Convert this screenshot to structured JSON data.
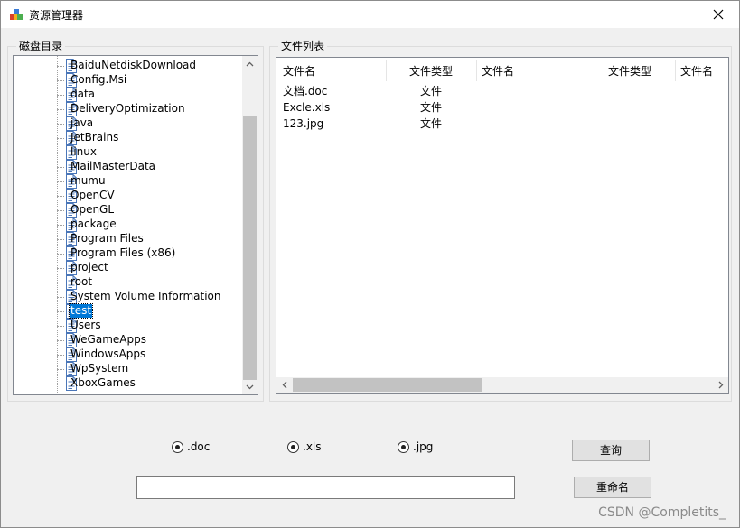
{
  "window": {
    "title": "资源管理器"
  },
  "tree_group": {
    "label": "磁盘目录"
  },
  "tree": {
    "items": [
      "BaiduNetdiskDownload",
      "Config.Msi",
      "data",
      "DeliveryOptimization",
      "java",
      "JetBrains",
      "linux",
      "MailMasterData",
      "mumu",
      "OpenCV",
      "OpenGL",
      "package",
      "Program Files",
      "Program Files (x86)",
      "project",
      "root",
      "System Volume Information",
      "test",
      "Users",
      "WeGameApps",
      "WindowsApps",
      "WpSystem",
      "XboxGames"
    ],
    "selected": "test"
  },
  "list_group": {
    "label": "文件列表"
  },
  "file_list": {
    "columns": [
      "文件名",
      "文件类型",
      "文件名",
      "文件类型",
      "文件名"
    ],
    "rows": [
      {
        "name": "文档.doc",
        "type": "文件"
      },
      {
        "name": "Excle.xls",
        "type": "文件"
      },
      {
        "name": "123.jpg",
        "type": "文件"
      }
    ]
  },
  "filters": {
    "doc": {
      "label": ".doc",
      "checked": true
    },
    "xls": {
      "label": ".xls",
      "checked": true
    },
    "jpg": {
      "label": ".jpg",
      "checked": true
    }
  },
  "buttons": {
    "query": "查询",
    "rename": "重命名"
  },
  "rename_input": {
    "value": ""
  },
  "watermark": "CSDN @Completits_"
}
